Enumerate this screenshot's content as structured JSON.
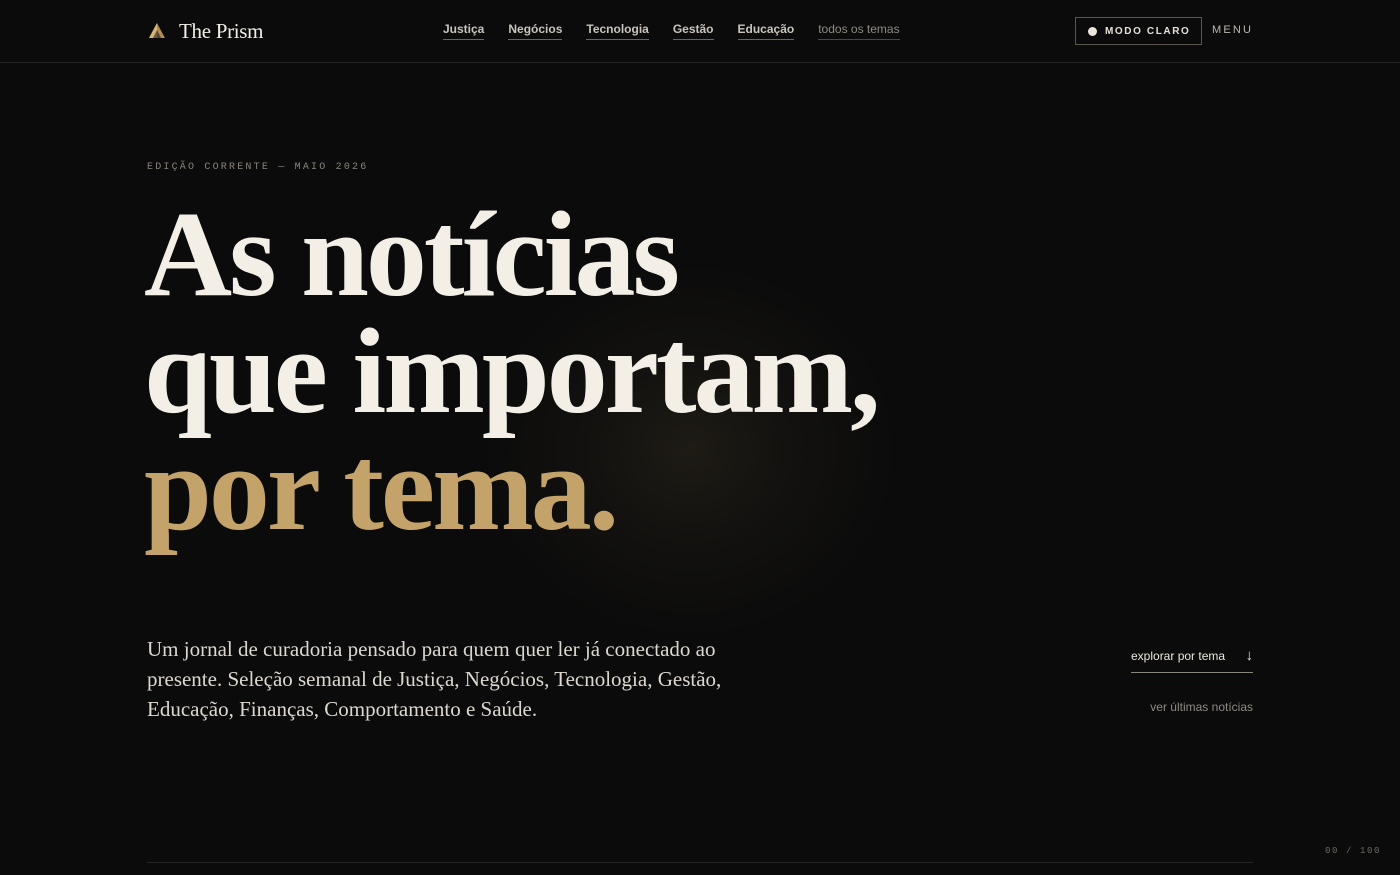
{
  "header": {
    "brand_name": "The Prism",
    "brand_icon": "prism-triangle-icon",
    "nav": [
      {
        "label": "Justiça"
      },
      {
        "label": "Negócios"
      },
      {
        "label": "Tecnologia"
      },
      {
        "label": "Gestão"
      },
      {
        "label": "Educação"
      },
      {
        "label": "todos os temas"
      }
    ],
    "mode_toggle_label": "MODO CLARO",
    "menu_label": "MENU"
  },
  "hero": {
    "edition": "EDIÇÃO CORRENTE — MAIO 2026",
    "headline_line1": "As notícias",
    "headline_line2": "que importam,",
    "headline_line3": "por tema.",
    "lede": "Um jornal de curadoria pensado para quem quer ler já conectado ao presente. Seleção semanal de Justiça, Negócios, Tecnologia, Gestão, Educação, Finanças, Comportamento e Saúde.",
    "explore_label": "explorar por tema",
    "explore_icon": "arrow-down-icon",
    "latest_label": "ver últimas notícias"
  },
  "scroll_indicator": "00 / 100",
  "colors": {
    "background": "#0b0b0b",
    "text": "#f4efe6",
    "accent_gold": "#c3a36a"
  }
}
